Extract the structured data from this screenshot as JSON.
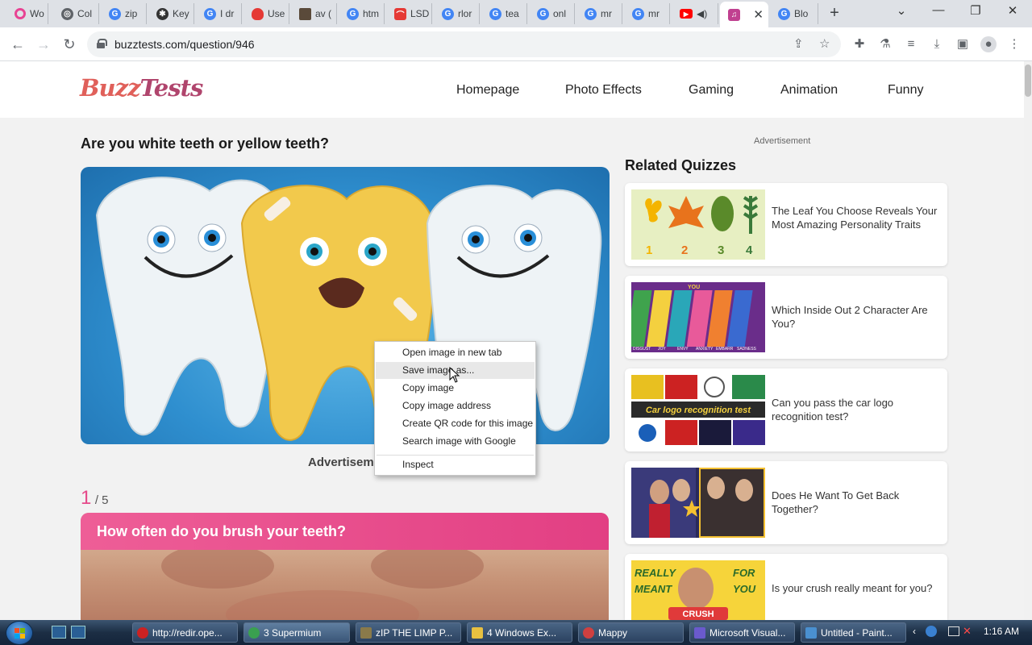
{
  "browser": {
    "tabs": [
      {
        "label": "Wo",
        "favicon": "opera-ring-icon",
        "color": "#e84393"
      },
      {
        "label": "Col",
        "favicon": "globe-icon",
        "color": "#5f6368"
      },
      {
        "label": "zip",
        "favicon": "google-icon",
        "color": "#4285f4"
      },
      {
        "label": "Key",
        "favicon": "bug-icon",
        "color": "#333333"
      },
      {
        "label": "I dr",
        "favicon": "google-icon",
        "color": "#4285f4"
      },
      {
        "label": "Use",
        "favicon": "flame-icon",
        "color": "#e53935"
      },
      {
        "label": "av (",
        "favicon": "video-thumb-icon",
        "color": "#5a4a3a"
      },
      {
        "label": "htm",
        "favicon": "google-icon",
        "color": "#4285f4"
      },
      {
        "label": "LSD",
        "favicon": "graph-icon",
        "color": "#e53935"
      },
      {
        "label": "rlor",
        "favicon": "google-icon",
        "color": "#4285f4"
      },
      {
        "label": "tea",
        "favicon": "google-icon",
        "color": "#4285f4"
      },
      {
        "label": "onl",
        "favicon": "google-icon",
        "color": "#4285f4"
      },
      {
        "label": "mr",
        "favicon": "google-icon",
        "color": "#4285f4"
      },
      {
        "label": "mr",
        "favicon": "google-icon",
        "color": "#4285f4"
      },
      {
        "label": "",
        "favicon": "youtube-icon",
        "color": "#ff0000"
      },
      {
        "label": "",
        "favicon": "buzztests-icon",
        "color": "#c04090"
      },
      {
        "label": "Blo",
        "favicon": "google-icon",
        "color": "#4285f4"
      }
    ],
    "url": "buzztests.com/question/946"
  },
  "site": {
    "logo_part1": "Buzz",
    "logo_part2": "Tests",
    "nav": [
      "Homepage",
      "Photo Effects",
      "Gaming",
      "Animation",
      "Funny"
    ]
  },
  "quiz": {
    "title": "Are you white teeth or yellow teeth?",
    "ad_label": "Advertisement",
    "current_question": "1",
    "total_questions": "/ 5",
    "question_text": "How often do you brush your teeth?"
  },
  "sidebar": {
    "ad_label": "Advertisement",
    "related_title": "Related Quizzes",
    "quizzes": [
      {
        "title": "The Leaf You Choose Reveals Your Most Amazing Personality Traits"
      },
      {
        "title": "Which Inside Out 2 Character Are You?"
      },
      {
        "title": "Can you pass the car logo recognition test?"
      },
      {
        "title": "Does He Want To Get Back Together?"
      },
      {
        "title": "Is your crush really meant for you?"
      }
    ],
    "leaf_numbers": [
      "1",
      "2",
      "3",
      "4"
    ],
    "car_banner": "Car logo recognition test",
    "crush_words": [
      "REALLY",
      "FOR",
      "MEANT",
      "YOU",
      "CRUSH"
    ],
    "inside_out_labels": [
      "YOU",
      "DISGUST",
      "JOY",
      "ENVY",
      "ANXIETY",
      "EMBARR",
      "SADNESS"
    ]
  },
  "context_menu": {
    "items": [
      "Open image in new tab",
      "Save image as...",
      "Copy image",
      "Copy image address",
      "Create QR code for this image",
      "Search image with Google",
      "Inspect"
    ],
    "highlighted_index": 1
  },
  "taskbar": {
    "items": [
      {
        "label": "http://redir.ope...",
        "icon": "opera-icon",
        "color": "#cc2222"
      },
      {
        "label": "3 Supermium",
        "icon": "supermium-icon",
        "color": "#3aa050"
      },
      {
        "label": "zIP THE LIMP P...",
        "icon": "image-icon",
        "color": "#8a7a4a"
      },
      {
        "label": "4 Windows Ex...",
        "icon": "folder-icon",
        "color": "#e8c040"
      },
      {
        "label": "Mappy",
        "icon": "mappy-icon",
        "color": "#d04040"
      },
      {
        "label": "Microsoft Visual...",
        "icon": "visual-studio-icon",
        "color": "#6a5acd"
      },
      {
        "label": "Untitled - Paint...",
        "icon": "paint-icon",
        "color": "#4a90d0"
      }
    ],
    "clock": "1:16 AM"
  }
}
